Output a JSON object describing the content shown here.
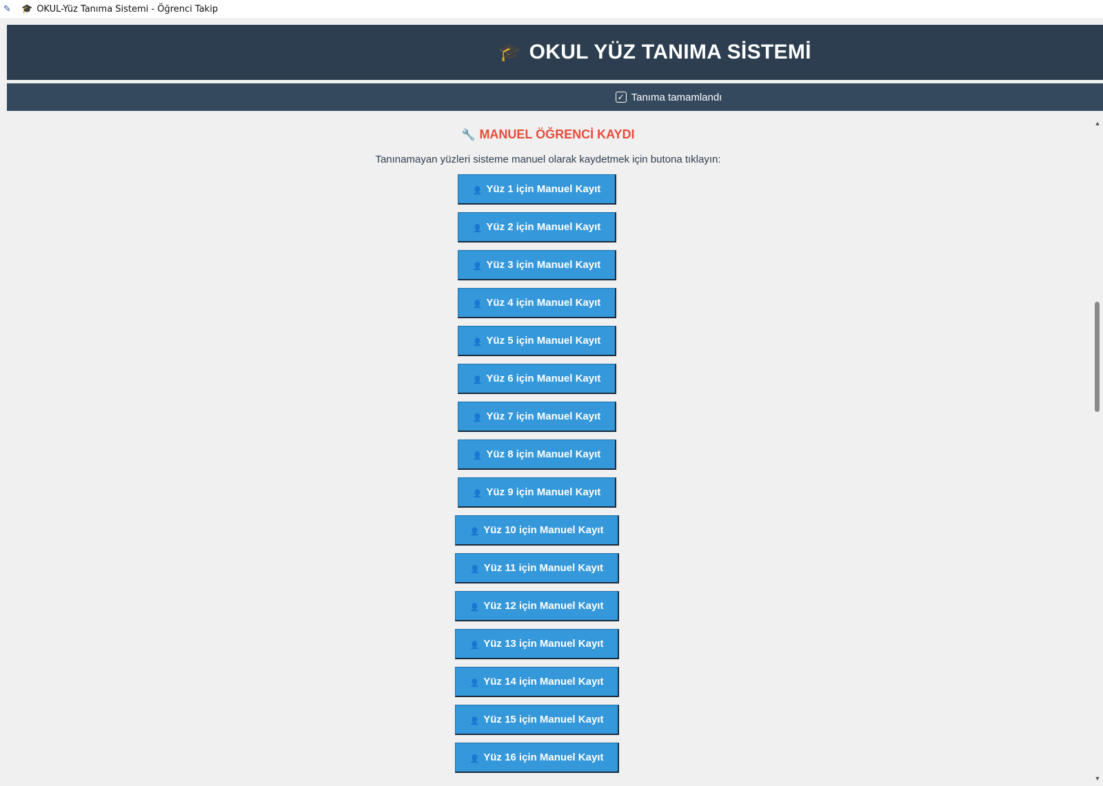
{
  "window": {
    "title": "OKUL-Yüz Tanıma Sistemi - Öğrenci Takip",
    "app_icon": "feather-icon",
    "title_icon": "graduation-cap-icon"
  },
  "header": {
    "icon": "graduation-cap-icon",
    "title": "OKUL YÜZ TANIMA SİSTEMİ",
    "background": "#2c3e50"
  },
  "status": {
    "icon": "checkbox-checked-icon",
    "text": "Tanıma tamamlandı",
    "background": "#34495e"
  },
  "manual": {
    "icon": "wrench-icon",
    "title": "MANUEL ÖĞRENCİ KAYDI",
    "title_color": "#e74c3c",
    "description": "Tanınamayan yüzleri sisteme manuel olarak kaydetmek için butona tıklayın:",
    "button_color": "#3498db",
    "button_icon": "person-icon",
    "buttons": [
      "Yüz 1 için Manuel Kayıt",
      "Yüz 2 için Manuel Kayıt",
      "Yüz 3 için Manuel Kayıt",
      "Yüz 4 için Manuel Kayıt",
      "Yüz 5 için Manuel Kayıt",
      "Yüz 6 için Manuel Kayıt",
      "Yüz 7 için Manuel Kayıt",
      "Yüz 8 için Manuel Kayıt",
      "Yüz 9 için Manuel Kayıt",
      "Yüz 10 için Manuel Kayıt",
      "Yüz 11 için Manuel Kayıt",
      "Yüz 12 için Manuel Kayıt",
      "Yüz 13 için Manuel Kayıt",
      "Yüz 14 için Manuel Kayıt",
      "Yüz 15 için Manuel Kayıt",
      "Yüz 16 için Manuel Kayıt"
    ]
  }
}
